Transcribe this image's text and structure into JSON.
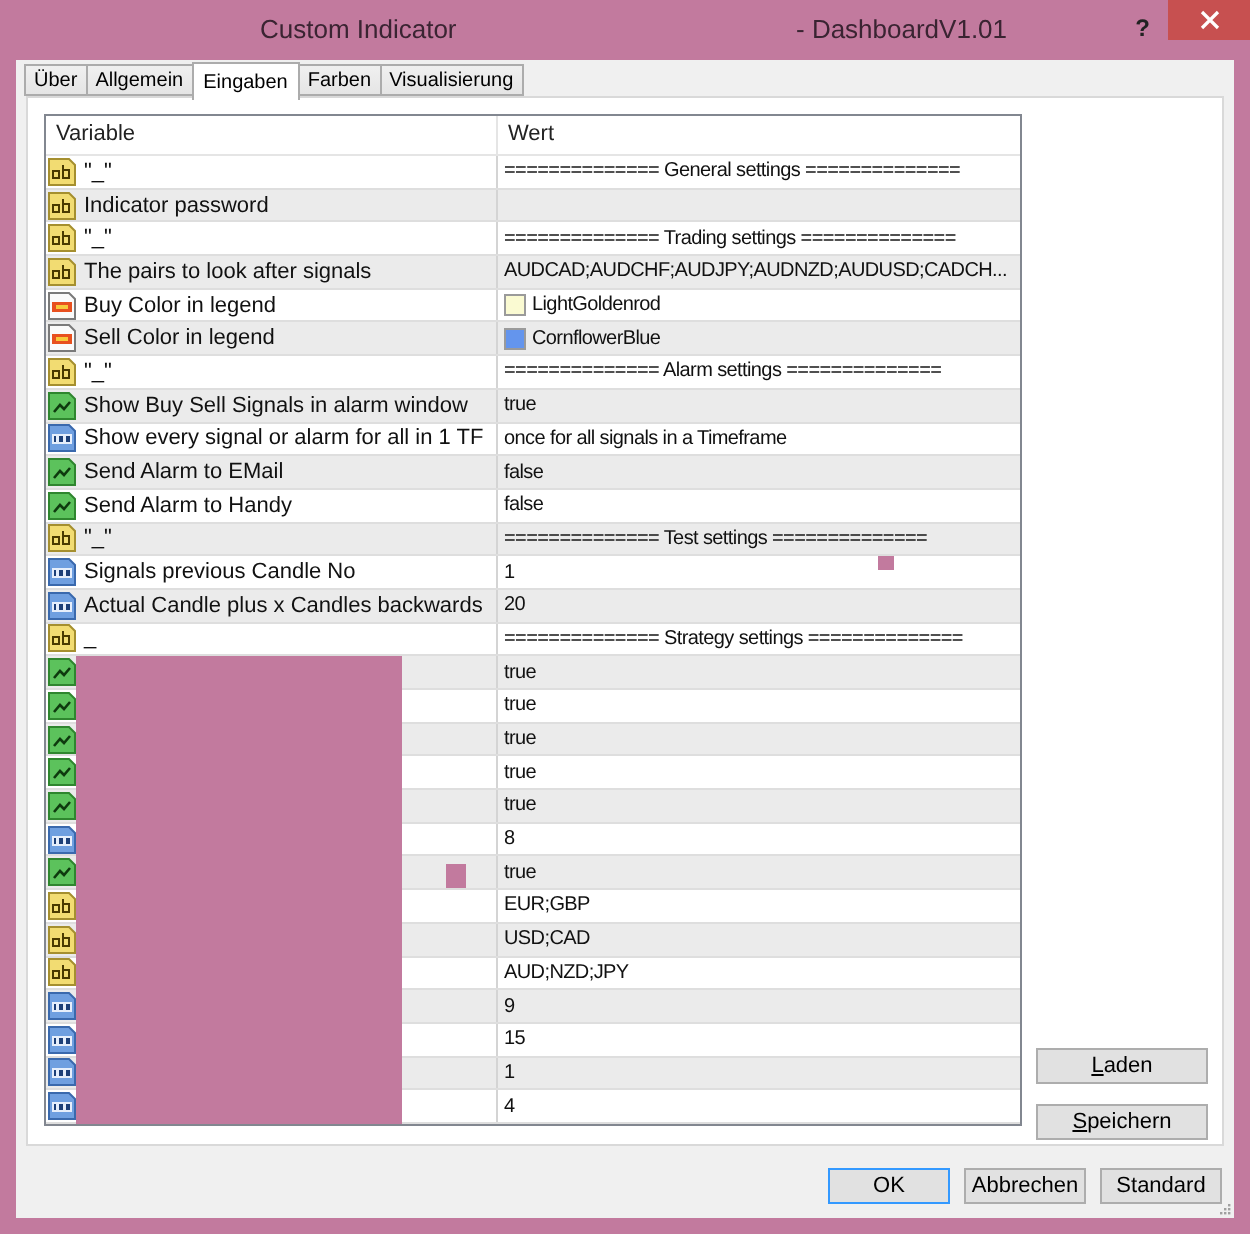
{
  "window": {
    "title": "Custom Indicator",
    "subtitle": "- DashboardV1.01",
    "help": "?"
  },
  "tabs": [
    {
      "label": "Über",
      "selected": false
    },
    {
      "label": "Allgemein",
      "selected": false
    },
    {
      "label": "Eingaben",
      "selected": true
    },
    {
      "label": "Farben",
      "selected": false
    },
    {
      "label": "Visualisierung",
      "selected": false
    }
  ],
  "table": {
    "columns": [
      "Variable",
      "Wert"
    ],
    "rows": [
      {
        "kind": "text",
        "name": "\"_\"",
        "value": "============== General settings =============="
      },
      {
        "kind": "text",
        "name": "Indicator password"
      },
      {
        "kind": "text",
        "name": "\"_\"",
        "value": "============== Trading settings =============="
      },
      {
        "kind": "text",
        "name": "The pairs to look after signals",
        "value": "AUDCAD;AUDCHF;AUDJPY;AUDNZD;AUDUSD;CADCH..."
      },
      {
        "kind": "color",
        "name": "Buy Color in legend",
        "value": "LightGoldenrod",
        "color": "#fafad2"
      },
      {
        "kind": "color",
        "name": "Sell Color in legend",
        "value": "CornflowerBlue",
        "color": "#6495ed"
      },
      {
        "kind": "text",
        "name": "\"_\"",
        "value": "============== Alarm settings =============="
      },
      {
        "kind": "bool",
        "name": "Show Buy Sell Signals in alarm window",
        "value": "true"
      },
      {
        "kind": "number",
        "name": "Show every signal or alarm for all in 1 TF",
        "value": "once for all signals in a Timeframe"
      },
      {
        "kind": "bool",
        "name": "Send Alarm to EMail",
        "value": "false"
      },
      {
        "kind": "bool",
        "name": "Send Alarm to Handy",
        "value": "false"
      },
      {
        "kind": "text",
        "name": "\"_\"",
        "value": "============== Test settings =============="
      },
      {
        "kind": "number",
        "name": "Signals previous Candle No",
        "value": "1",
        "value_smudged": true
      },
      {
        "kind": "number",
        "name": "Actual Candle plus x Candles backwards",
        "value": "20"
      },
      {
        "kind": "text",
        "name": "_",
        "value": "============== Strategy settings =============="
      },
      {
        "kind": "bool",
        "redacted": true,
        "value": "true"
      },
      {
        "kind": "bool",
        "redacted": true,
        "value": "true"
      },
      {
        "kind": "bool",
        "redacted": true,
        "value": "true"
      },
      {
        "kind": "bool",
        "redacted": true,
        "value": "true"
      },
      {
        "kind": "bool",
        "redacted": true,
        "value": "true"
      },
      {
        "kind": "number",
        "redacted": true,
        "value": "8"
      },
      {
        "kind": "bool",
        "redacted": true,
        "value": "true",
        "name_smudged": true
      },
      {
        "kind": "text",
        "redacted": true,
        "value": "EUR;GBP"
      },
      {
        "kind": "text",
        "redacted": true,
        "value": "USD;CAD"
      },
      {
        "kind": "text",
        "redacted": true,
        "value": "AUD;NZD;JPY"
      },
      {
        "kind": "number",
        "redacted": true,
        "value": "9"
      },
      {
        "kind": "number",
        "redacted": true,
        "value": "15"
      },
      {
        "kind": "number",
        "redacted": true,
        "value": "1"
      },
      {
        "kind": "number",
        "redacted": true,
        "value": "4"
      }
    ]
  },
  "side_buttons": [
    {
      "label": "Laden",
      "mnemonic": true
    },
    {
      "label": "Speichern",
      "mnemonic": true
    }
  ],
  "buttons": [
    {
      "label": "OK",
      "default": true
    },
    {
      "label": "Abbrechen",
      "default": false
    },
    {
      "label": "Standard",
      "default": false
    }
  ]
}
